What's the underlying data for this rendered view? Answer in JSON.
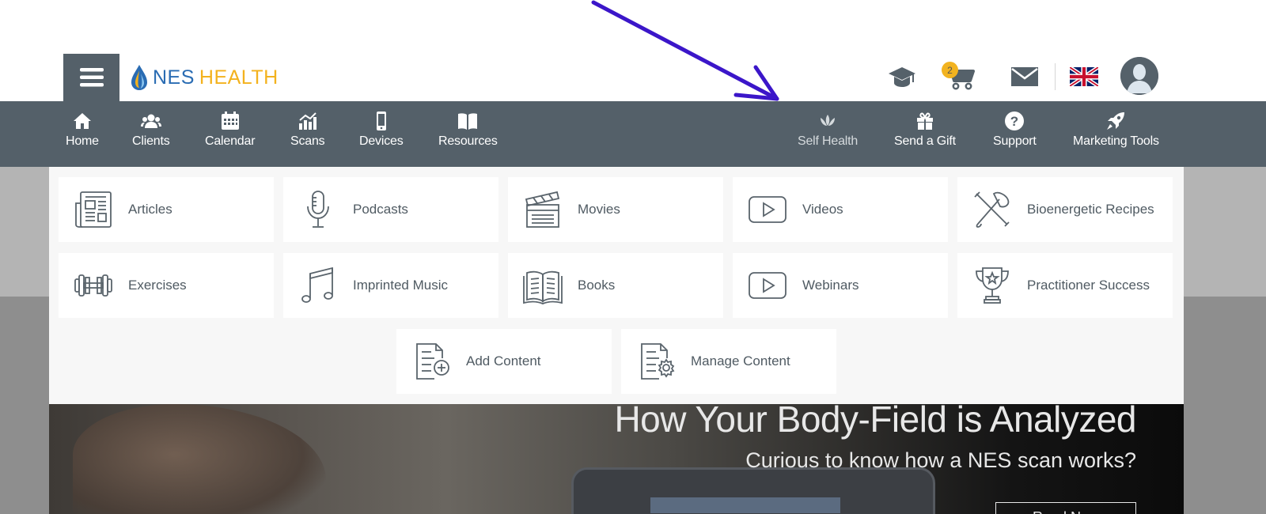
{
  "brand": {
    "name_part1": "NES",
    "name_part2": "HEALTH",
    "nes_color": "#2a6cb3",
    "health_color": "#f3b21e"
  },
  "header": {
    "menu_icon": "hamburger-icon",
    "icons": [
      "graduation-cap-icon",
      "cart-icon",
      "mail-icon",
      "uk-flag-icon",
      "user-avatar-icon"
    ],
    "cart_count": "2"
  },
  "nav": {
    "left": [
      {
        "label": "Home",
        "icon": "home-icon"
      },
      {
        "label": "Clients",
        "icon": "users-icon"
      },
      {
        "label": "Calendar",
        "icon": "calendar-icon"
      },
      {
        "label": "Scans",
        "icon": "chart-icon"
      },
      {
        "label": "Devices",
        "icon": "mobile-icon"
      },
      {
        "label": "Resources",
        "icon": "book-icon"
      }
    ],
    "right": [
      {
        "label": "Self Health",
        "icon": "lotus-icon"
      },
      {
        "label": "Send a Gift",
        "icon": "gift-icon"
      },
      {
        "label": "Support",
        "icon": "question-icon"
      },
      {
        "label": "Marketing Tools",
        "icon": "rocket-icon"
      }
    ]
  },
  "resources_menu": {
    "items": [
      {
        "label": "Articles",
        "icon": "newspaper-icon"
      },
      {
        "label": "Podcasts",
        "icon": "microphone-icon"
      },
      {
        "label": "Movies",
        "icon": "clapperboard-icon"
      },
      {
        "label": "Videos",
        "icon": "play-icon"
      },
      {
        "label": "Bioenergetic Recipes",
        "icon": "cooking-utensils-icon"
      },
      {
        "label": "Exercises",
        "icon": "dumbbell-icon"
      },
      {
        "label": "Imprinted Music",
        "icon": "music-note-icon"
      },
      {
        "label": "Books",
        "icon": "open-book-icon"
      },
      {
        "label": "Webinars",
        "icon": "play-icon"
      },
      {
        "label": "Practitioner Success",
        "icon": "trophy-icon"
      },
      {
        "label": "Add Content",
        "icon": "add-document-icon"
      },
      {
        "label": "Manage Content",
        "icon": "document-settings-icon"
      }
    ]
  },
  "banner": {
    "title": "How Your Body-Field is Analyzed",
    "subtitle": "Curious to know how a NES scan works?",
    "button_label": "Read Now"
  },
  "colors": {
    "navbar": "#546069",
    "annotation_arrow": "#3b16c9",
    "badge": "#f2b320"
  }
}
